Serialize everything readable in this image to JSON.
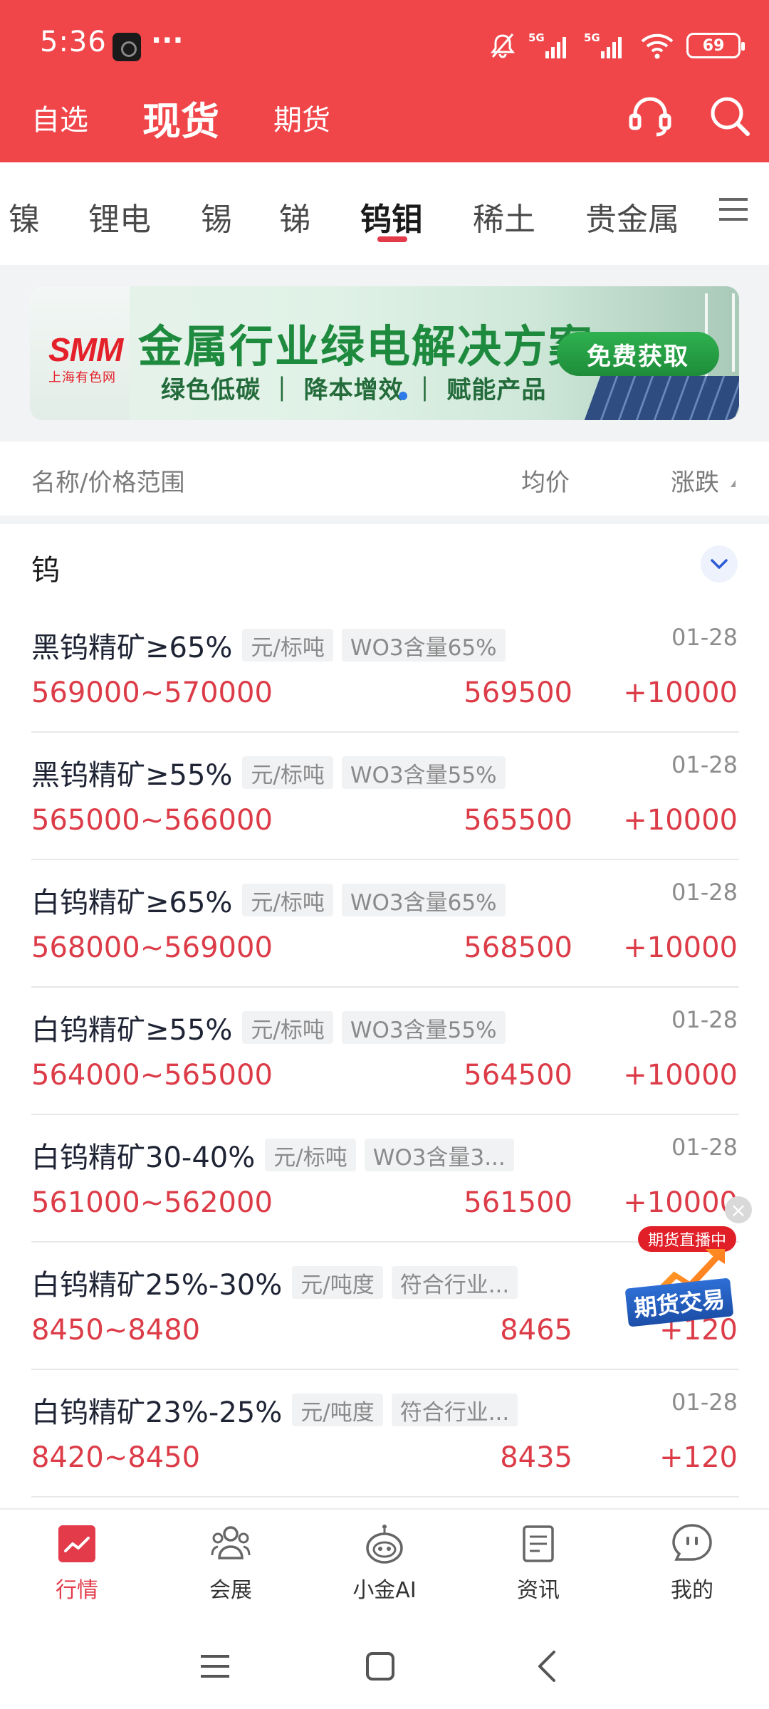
{
  "status_bar": {
    "time": "5:36",
    "dots": "···",
    "network_1": "5G",
    "network_2": "5G",
    "battery": "69"
  },
  "nav": {
    "tabs": [
      {
        "label": "自选"
      },
      {
        "label": "现货",
        "active": true
      },
      {
        "label": "期货"
      }
    ]
  },
  "categories": [
    "镍",
    "锂电",
    "锡",
    "锑",
    "钨钼",
    "稀土",
    "贵金属"
  ],
  "active_category": "钨钼",
  "banner": {
    "logo_text": "SMM",
    "logo_cn": "上海有色网",
    "title": "金属行业绿电解决方案",
    "subtitle": "绿色低碳 ｜ 降本增效 ｜ 赋能产品",
    "button": "免费获取"
  },
  "columns": {
    "name": "名称/价格范围",
    "avg": "均价",
    "change": "涨跌"
  },
  "section": {
    "title": "钨"
  },
  "rows": [
    {
      "name": "黑钨精矿≥65%",
      "unit": "元/标吨",
      "spec": "WO3含量65%",
      "date": "01-28",
      "range": "569000~570000",
      "avg": "569500",
      "change": "+10000"
    },
    {
      "name": "黑钨精矿≥55%",
      "unit": "元/标吨",
      "spec": "WO3含量55%",
      "date": "01-28",
      "range": "565000~566000",
      "avg": "565500",
      "change": "+10000"
    },
    {
      "name": "白钨精矿≥65%",
      "unit": "元/标吨",
      "spec": "WO3含量65%",
      "date": "01-28",
      "range": "568000~569000",
      "avg": "568500",
      "change": "+10000"
    },
    {
      "name": "白钨精矿≥55%",
      "unit": "元/标吨",
      "spec": "WO3含量55%",
      "date": "01-28",
      "range": "564000~565000",
      "avg": "564500",
      "change": "+10000"
    },
    {
      "name": "白钨精矿30-40%",
      "unit": "元/标吨",
      "spec": "WO3含量3...",
      "date": "01-28",
      "range": "561000~562000",
      "avg": "561500",
      "change": "+10000"
    },
    {
      "name": "白钨精矿25%-30%",
      "unit": "元/吨度",
      "spec": "符合行业...",
      "date": "",
      "range": "8450~8480",
      "avg": "8465",
      "change": "+120"
    },
    {
      "name": "白钨精矿23%-25%",
      "unit": "元/吨度",
      "spec": "符合行业...",
      "date": "01-28",
      "range": "8420~8450",
      "avg": "8435",
      "change": "+120"
    }
  ],
  "float_ad": {
    "live": "期货直播中",
    "label": "期货交易"
  },
  "bottom_nav": [
    {
      "label": "行情",
      "icon": "chart-icon",
      "active": true
    },
    {
      "label": "会展",
      "icon": "people-icon"
    },
    {
      "label": "小金AI",
      "icon": "robot-icon"
    },
    {
      "label": "资讯",
      "icon": "document-icon"
    },
    {
      "label": "我的",
      "icon": "profile-icon"
    }
  ],
  "colors": {
    "brand_red": "#f0464a",
    "price_red": "#dc3c48",
    "active_underline": "#e33b4a"
  }
}
